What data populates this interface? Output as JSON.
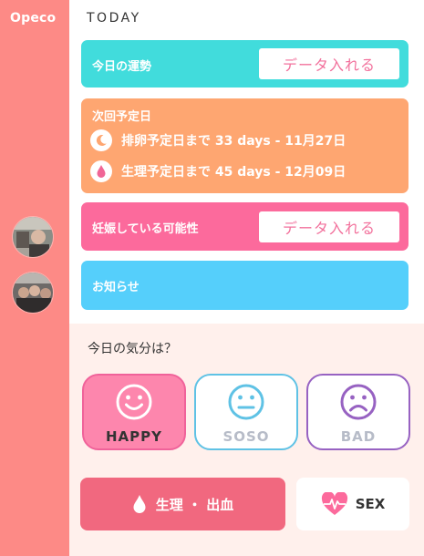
{
  "app": {
    "name": "Opeco"
  },
  "today": {
    "label": "TODAY"
  },
  "fortune": {
    "title": "今日の運勢",
    "button": "データ入れる"
  },
  "prediction": {
    "title": "次回予定日",
    "ovulation": "排卵予定日まで 33 days - 11月27日",
    "period": "生理予定日まで 45 days - 12月09日"
  },
  "pregnancy": {
    "title": "妊娠している可能性",
    "button": "データ入れる"
  },
  "notice": {
    "title": "お知らせ"
  },
  "mood": {
    "question": "今日の気分は？",
    "happy": "HAPPY",
    "soso": "SOSO",
    "bad": "BAD"
  },
  "actions": {
    "period_button": "生理 ・ 出血",
    "sex_button": "SEX"
  },
  "colors": {
    "sidebar": "#fd8a86",
    "fortune_card": "#41dcdc",
    "prediction_card": "#fea671",
    "pregnancy_card": "#fc6a9c",
    "notice_card": "#55cffb",
    "happy": "#f0629a",
    "soso": "#5fc2e5",
    "bad": "#9762c2",
    "period_button": "#f1687f"
  },
  "icons": {
    "ovulation": "moon-icon",
    "period": "drop-icon",
    "happy": "smile-face-icon",
    "soso": "neutral-face-icon",
    "bad": "sad-face-icon",
    "period_button": "drop-icon",
    "sex_button": "heartbeat-icon"
  }
}
